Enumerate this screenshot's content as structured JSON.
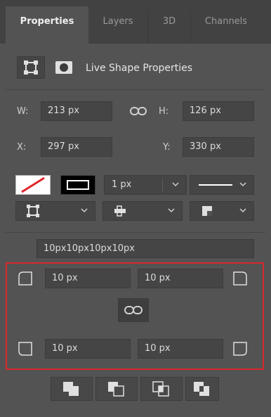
{
  "tabs": [
    {
      "label": "Properties",
      "active": true
    },
    {
      "label": "Layers",
      "active": false
    },
    {
      "label": "3D",
      "active": false
    },
    {
      "label": "Channels",
      "active": false
    }
  ],
  "header": {
    "title": "Live Shape Properties",
    "icons": [
      "transform-shape-icon",
      "mask-icon"
    ]
  },
  "geometry": {
    "w_label": "W:",
    "w_value": "213 px",
    "h_label": "H:",
    "h_value": "126 px",
    "x_label": "X:",
    "x_value": "297 px",
    "y_label": "Y:",
    "y_value": "330 px"
  },
  "stroke": {
    "fill": "none",
    "stroke_swatch": "black-stroke",
    "width_value": "1 px",
    "line_style": "solid"
  },
  "align_options": [
    "stroke-align-inside",
    "cap-type",
    "corner-type"
  ],
  "corners": {
    "combined": "10px10px10px10px",
    "top_left": "10 px",
    "top_right": "10 px",
    "bottom_left": "10 px",
    "bottom_right": "10 px"
  },
  "path_ops": [
    "combine-shapes",
    "subtract-front-shape",
    "intersect-shape-areas",
    "exclude-overlapping-shapes"
  ],
  "colors": {
    "panel_bg": "#535353",
    "tab_bar_bg": "#424242",
    "field_bg": "#454545",
    "highlight": "#d8282e"
  }
}
